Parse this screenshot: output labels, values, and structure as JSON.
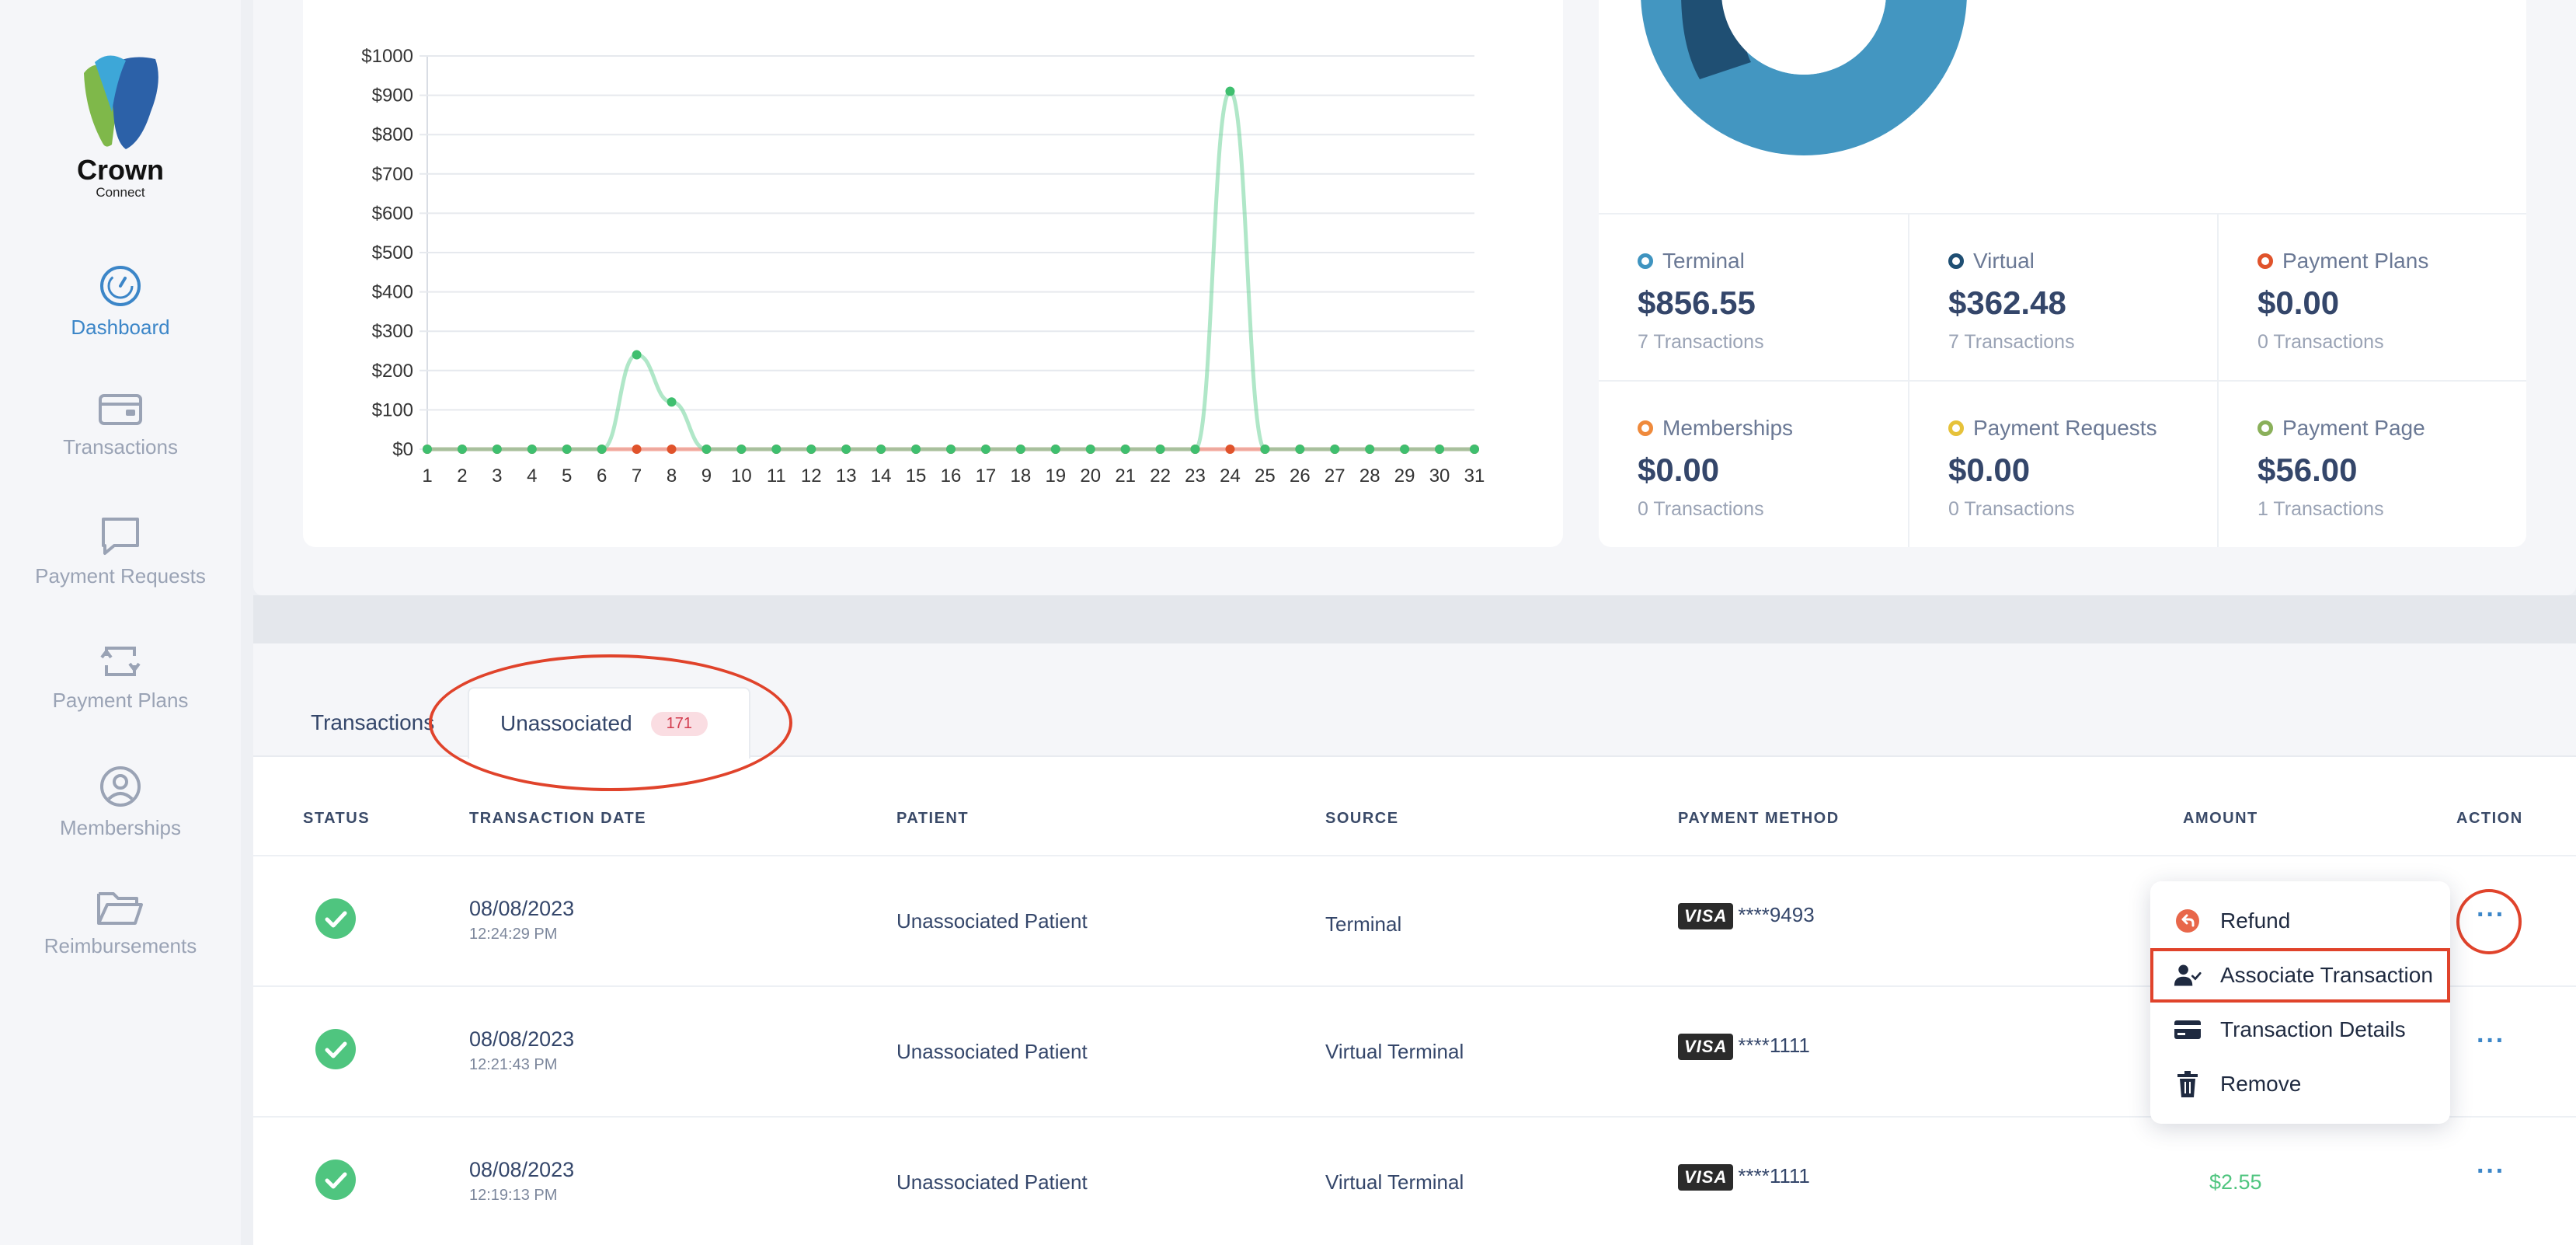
{
  "app": {
    "brand": "Crown",
    "brand_sub": "Connect"
  },
  "sidebar": {
    "items": [
      {
        "label": "Dashboard",
        "icon": "speedometer-icon",
        "active": true
      },
      {
        "label": "Transactions",
        "icon": "wallet-icon"
      },
      {
        "label": "Payment Requests",
        "icon": "chat-icon"
      },
      {
        "label": "Payment Plans",
        "icon": "recurring-icon"
      },
      {
        "label": "Memberships",
        "icon": "user-circle-icon"
      },
      {
        "label": "Reimbursements",
        "icon": "folder-icon"
      }
    ]
  },
  "chart_data": {
    "type": "line",
    "x": [
      1,
      2,
      3,
      4,
      5,
      6,
      7,
      8,
      9,
      10,
      11,
      12,
      13,
      14,
      15,
      16,
      17,
      18,
      19,
      20,
      21,
      22,
      23,
      24,
      25,
      26,
      27,
      28,
      29,
      30,
      31
    ],
    "y_ticks": [
      "$0",
      "$100",
      "$200",
      "$300",
      "$400",
      "$500",
      "$600",
      "$700",
      "$800",
      "$900",
      "$1000"
    ],
    "ylim": [
      0,
      1000
    ],
    "series": [
      {
        "color": "#6fd39a",
        "values": [
          0,
          0,
          0,
          0,
          0,
          0,
          240,
          120,
          0,
          0,
          0,
          0,
          0,
          0,
          0,
          0,
          0,
          0,
          0,
          0,
          0,
          0,
          0,
          910,
          0,
          0,
          0,
          0,
          0,
          0,
          0
        ]
      },
      {
        "color": "#f08a7a",
        "values": [
          0,
          0,
          0,
          0,
          0,
          0,
          0,
          0,
          0,
          0,
          0,
          0,
          0,
          0,
          0,
          0,
          0,
          0,
          0,
          0,
          0,
          0,
          0,
          0,
          0,
          0,
          0,
          0,
          0,
          0,
          0
        ]
      }
    ],
    "grid": true
  },
  "stats": [
    {
      "name": "Terminal",
      "amount": "$856.55",
      "count": "7 Transactions",
      "color": "#3f94c0"
    },
    {
      "name": "Virtual",
      "amount": "$362.48",
      "count": "7 Transactions",
      "color": "#1f4f73"
    },
    {
      "name": "Payment Plans",
      "amount": "$0.00",
      "count": "0 Transactions",
      "color": "#e0532b"
    },
    {
      "name": "Memberships",
      "amount": "$0.00",
      "count": "0 Transactions",
      "color": "#ef8a3c"
    },
    {
      "name": "Payment Requests",
      "amount": "$0.00",
      "count": "0 Transactions",
      "color": "#e6c23a"
    },
    {
      "name": "Payment Page",
      "amount": "$56.00",
      "count": "1 Transactions",
      "color": "#8ab05a"
    }
  ],
  "tabs": [
    {
      "label": "Transactions"
    },
    {
      "label": "Unassociated",
      "badge": "171"
    }
  ],
  "table": {
    "headers": [
      "STATUS",
      "TRANSACTION DATE",
      "PATIENT",
      "SOURCE",
      "PAYMENT METHOD",
      "AMOUNT",
      "ACTION"
    ],
    "rows": [
      {
        "date": "08/08/2023",
        "time": "12:24:29 PM",
        "patient": "Unassociated Patient",
        "source": "Terminal",
        "card": "****9493",
        "amount": ""
      },
      {
        "date": "08/08/2023",
        "time": "12:21:43 PM",
        "patient": "Unassociated Patient",
        "source": "Virtual Terminal",
        "card": "****1111",
        "amount": ""
      },
      {
        "date": "08/08/2023",
        "time": "12:19:13 PM",
        "patient": "Unassociated Patient",
        "source": "Virtual Terminal",
        "card": "****1111",
        "amount": "$2.55"
      }
    ],
    "visa_label": "VISA"
  },
  "action_menu": {
    "items": [
      {
        "label": "Refund",
        "icon": "refund-icon"
      },
      {
        "label": "Associate Transaction",
        "icon": "user-check-icon",
        "highlighted": true
      },
      {
        "label": "Transaction Details",
        "icon": "credit-card-icon"
      },
      {
        "label": "Remove",
        "icon": "trash-icon"
      }
    ]
  },
  "more_label": "···"
}
